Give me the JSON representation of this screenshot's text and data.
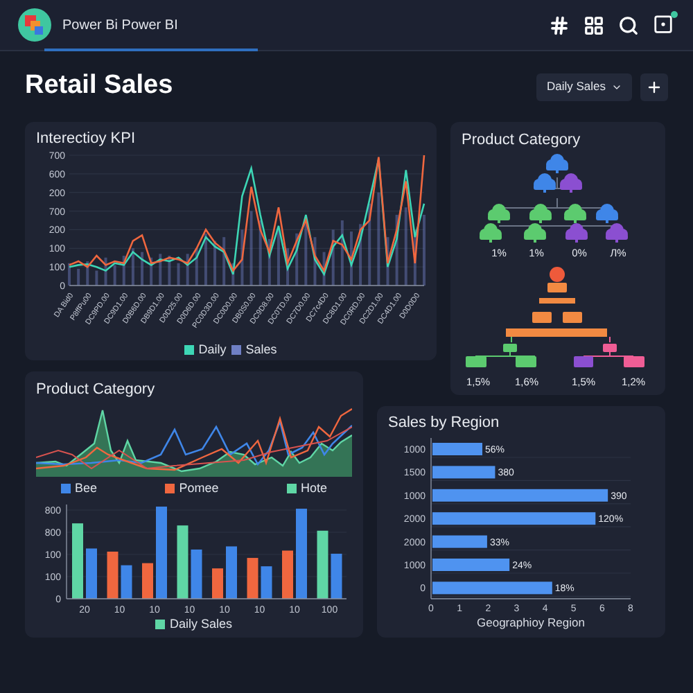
{
  "app": {
    "name": "Power Bi Power BI"
  },
  "page": {
    "title": "Retail Sales",
    "view_select": {
      "value": "Daily Sales"
    }
  },
  "kpi_card": {
    "title": "Interectioy KPI",
    "y_axis_labels": [
      "700",
      "600",
      "200",
      "700",
      "200",
      "100",
      "100",
      "0"
    ],
    "x_axis_labels": [
      "DA Bid0",
      "P8ffPu00",
      "DC9PD.00",
      "DC9D1.00",
      "D0B6D.00",
      "DB9D1.00",
      "D0D25.00",
      "D0D6D.00",
      "PC0D3D.00",
      "DC0D0.00",
      "DB0S0.00",
      "DC9D8.00",
      "DC0TD.00",
      "DC7D0.00",
      "DC7c4D0",
      "DC8D1.00",
      "DC0RD.00",
      "DC2D1.00",
      "DC4D1.00",
      "D0D0D0"
    ],
    "legend": [
      {
        "label": "Daily",
        "color": "#3dd6b5"
      },
      {
        "label": "Sales",
        "color": "#6f7fc4"
      }
    ]
  },
  "tree_card": {
    "title": "Product Category",
    "cloud_labels": [
      "1%",
      "1%",
      "0%",
      "Л%"
    ],
    "org_labels": [
      "1,5%",
      "1,6%",
      "1,5%",
      "1,2%"
    ]
  },
  "category_card": {
    "title": "Product Category",
    "legend": [
      {
        "label": "Bee",
        "color": "#3f86e8"
      },
      {
        "label": "Pomee",
        "color": "#f0673f"
      },
      {
        "label": "Hote",
        "color": "#5fd6a5"
      }
    ],
    "bar_chart": {
      "y_axis_labels": [
        "800",
        "800",
        "100",
        "100",
        "0"
      ],
      "x_axis_labels": [
        "20",
        "10",
        "10",
        "10",
        "10",
        "10",
        "10",
        "100"
      ],
      "legend": [
        {
          "label": "Daily Sales",
          "color": "#5fd6a5"
        }
      ]
    }
  },
  "region_card": {
    "title": "Sales by Region",
    "bars": [
      {
        "category": "1000",
        "label": "56%"
      },
      {
        "category": "1500",
        "label": "380"
      },
      {
        "category": "1000",
        "label": "390"
      },
      {
        "category": "2000",
        "label": "120%"
      },
      {
        "category": "2000",
        "label": "33%"
      },
      {
        "category": "1000",
        "label": "24%"
      },
      {
        "category": "0",
        "label": "18%"
      }
    ],
    "x_axis_labels": [
      "0",
      "1",
      "2",
      "3",
      "4",
      "5",
      "6",
      "8"
    ],
    "x_axis_title": "Geographioy Region"
  }
}
